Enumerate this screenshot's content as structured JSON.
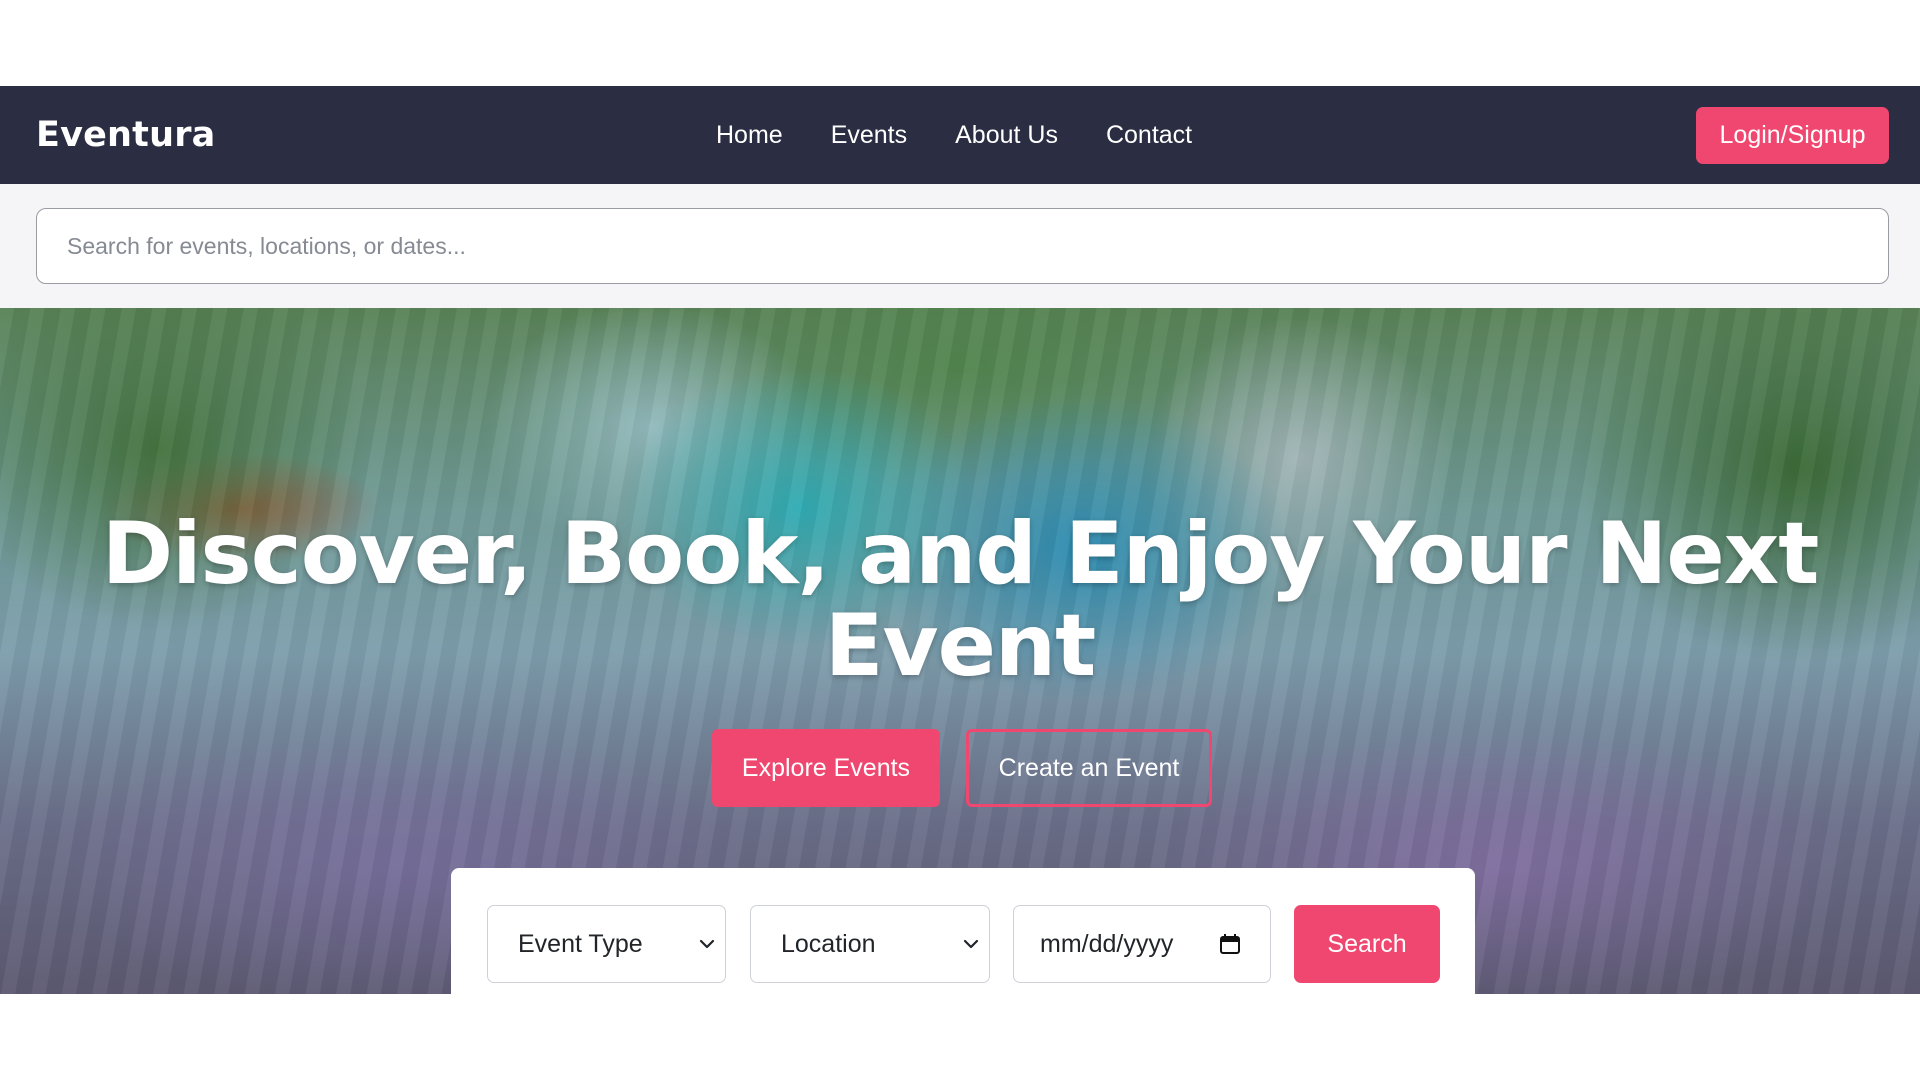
{
  "navbar": {
    "brand": "Eventura",
    "links": [
      {
        "label": "Home"
      },
      {
        "label": "Events"
      },
      {
        "label": "About Us"
      },
      {
        "label": "Contact"
      }
    ],
    "login_label": "Login/Signup"
  },
  "search": {
    "placeholder": "Search for events, locations, or dates...",
    "value": ""
  },
  "hero": {
    "title": "Discover, Book, and Enjoy Your Next Event",
    "explore_label": "Explore Events",
    "create_label": "Create an Event"
  },
  "filters": {
    "event_type": {
      "selected": "Event Type"
    },
    "location": {
      "selected": "Location"
    },
    "date": {
      "placeholder": "mm/dd/yyyy"
    },
    "search_label": "Search"
  },
  "colors": {
    "navbar_bg": "#2b2d42",
    "accent": "#ef476f",
    "white": "#ffffff"
  },
  "icons": {
    "select_chevron": "chevron-down-icon",
    "date_picker": "calendar-icon"
  }
}
